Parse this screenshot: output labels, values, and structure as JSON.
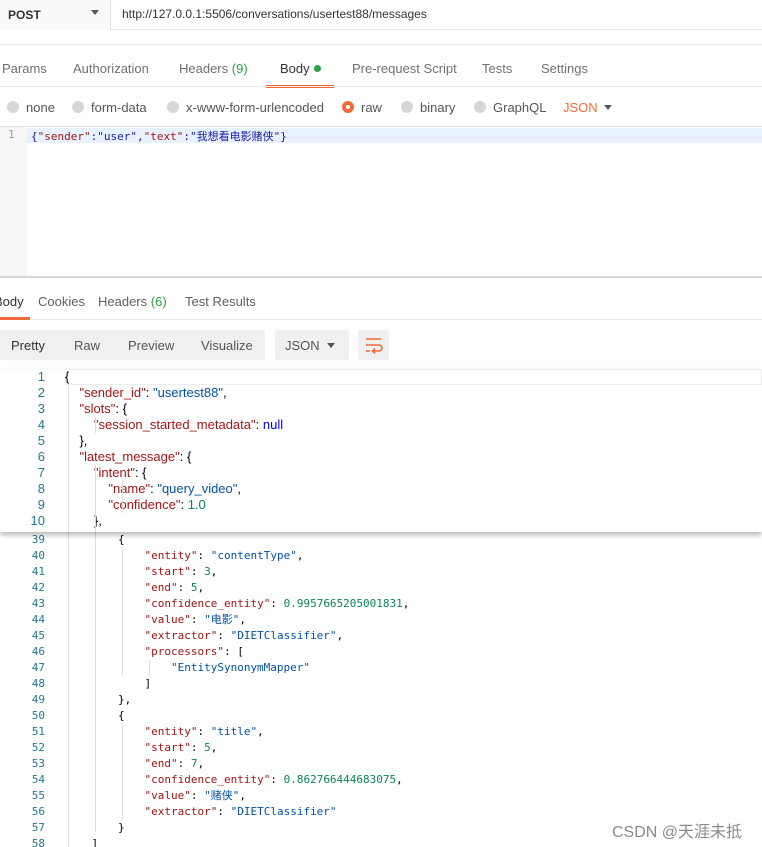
{
  "request": {
    "method": "POST",
    "url": "http://127.0.0.1:5506/conversations/usertest88/messages",
    "tabs": [
      {
        "label": "Params"
      },
      {
        "label": "Authorization"
      },
      {
        "label": "Headers",
        "count": "(9)"
      },
      {
        "label": "Body"
      },
      {
        "label": "Pre-request Script"
      },
      {
        "label": "Tests"
      },
      {
        "label": "Settings"
      }
    ],
    "body_types": [
      "none",
      "form-data",
      "x-www-form-urlencoded",
      "raw",
      "binary",
      "GraphQL"
    ],
    "selected_body_type": "raw",
    "format": "JSON",
    "body_line_number": "1",
    "body": [
      {
        "t": "{",
        "c": ""
      },
      {
        "t": "\"sender\"",
        "c": "k"
      },
      {
        "t": ":",
        "c": ""
      },
      {
        "t": "\"user\"",
        "c": ""
      },
      {
        "t": ",",
        "c": ""
      },
      {
        "t": "\"text\"",
        "c": "k"
      },
      {
        "t": ":",
        "c": ""
      },
      {
        "t": "\"我想看电影赌侠\"",
        "c": ""
      },
      {
        "t": "}",
        "c": ""
      }
    ]
  },
  "response": {
    "tabs": [
      {
        "label": "Body"
      },
      {
        "label": "Cookies"
      },
      {
        "label": "Headers",
        "count": "(6)"
      },
      {
        "label": "Test Results"
      }
    ],
    "views": [
      "Pretty",
      "Raw",
      "Preview",
      "Visualize"
    ],
    "format": "JSON",
    "sticky_lines": [
      {
        "no": "1",
        "tokens": [
          [
            "{",
            ""
          ]
        ]
      },
      {
        "no": "2",
        "tokens": [
          [
            "    ",
            ""
          ],
          [
            "\"sender_id\"",
            "k"
          ],
          [
            ": ",
            ""
          ],
          [
            "\"usertest88\"",
            "s"
          ],
          [
            ",",
            ""
          ]
        ]
      },
      {
        "no": "3",
        "tokens": [
          [
            "    ",
            ""
          ],
          [
            "\"slots\"",
            "k"
          ],
          [
            ": {",
            ""
          ]
        ]
      },
      {
        "no": "4",
        "tokens": [
          [
            "        ",
            ""
          ],
          [
            "\"session_started_metadata\"",
            "k"
          ],
          [
            ": ",
            ""
          ],
          [
            "null",
            "kw"
          ]
        ]
      },
      {
        "no": "5",
        "tokens": [
          [
            "    },",
            ""
          ]
        ]
      },
      {
        "no": "6",
        "tokens": [
          [
            "    ",
            ""
          ],
          [
            "\"latest_message\"",
            "k"
          ],
          [
            ": {",
            ""
          ]
        ]
      },
      {
        "no": "7",
        "tokens": [
          [
            "        ",
            ""
          ],
          [
            "\"intent\"",
            "k"
          ],
          [
            ": {",
            ""
          ]
        ]
      },
      {
        "no": "8",
        "tokens": [
          [
            "            ",
            ""
          ],
          [
            "\"name\"",
            "k"
          ],
          [
            ": ",
            ""
          ],
          [
            "\"query_video\"",
            "s"
          ],
          [
            ",",
            ""
          ]
        ]
      },
      {
        "no": "9",
        "tokens": [
          [
            "            ",
            ""
          ],
          [
            "\"confidence\"",
            "k"
          ],
          [
            ": ",
            ""
          ],
          [
            "1.0",
            "n"
          ]
        ]
      },
      {
        "no": "10",
        "tokens": [
          [
            "        },",
            ""
          ]
        ]
      }
    ],
    "lines": [
      {
        "no": "39",
        "tokens": [
          [
            "        {",
            ""
          ]
        ]
      },
      {
        "no": "40",
        "tokens": [
          [
            "            ",
            ""
          ],
          [
            "\"entity\"",
            "k"
          ],
          [
            ": ",
            ""
          ],
          [
            "\"contentType\"",
            "s"
          ],
          [
            ",",
            ""
          ]
        ]
      },
      {
        "no": "41",
        "tokens": [
          [
            "            ",
            ""
          ],
          [
            "\"start\"",
            "k"
          ],
          [
            ": ",
            ""
          ],
          [
            "3",
            "n"
          ],
          [
            ",",
            ""
          ]
        ]
      },
      {
        "no": "42",
        "tokens": [
          [
            "            ",
            ""
          ],
          [
            "\"end\"",
            "k"
          ],
          [
            ": ",
            ""
          ],
          [
            "5",
            "n"
          ],
          [
            ",",
            ""
          ]
        ]
      },
      {
        "no": "43",
        "tokens": [
          [
            "            ",
            ""
          ],
          [
            "\"confidence_entity\"",
            "k"
          ],
          [
            ": ",
            ""
          ],
          [
            "0.9957665205001831",
            "n"
          ],
          [
            ",",
            ""
          ]
        ]
      },
      {
        "no": "44",
        "tokens": [
          [
            "            ",
            ""
          ],
          [
            "\"value\"",
            "k"
          ],
          [
            ": ",
            ""
          ],
          [
            "\"电影\"",
            "s"
          ],
          [
            ",",
            ""
          ]
        ]
      },
      {
        "no": "45",
        "tokens": [
          [
            "            ",
            ""
          ],
          [
            "\"extractor\"",
            "k"
          ],
          [
            ": ",
            ""
          ],
          [
            "\"DIETClassifier\"",
            "s"
          ],
          [
            ",",
            ""
          ]
        ]
      },
      {
        "no": "46",
        "tokens": [
          [
            "            ",
            ""
          ],
          [
            "\"processors\"",
            "k"
          ],
          [
            ": [",
            ""
          ]
        ]
      },
      {
        "no": "47",
        "tokens": [
          [
            "                ",
            ""
          ],
          [
            "\"EntitySynonymMapper\"",
            "s"
          ]
        ]
      },
      {
        "no": "48",
        "tokens": [
          [
            "            ]",
            ""
          ]
        ]
      },
      {
        "no": "49",
        "tokens": [
          [
            "        },",
            ""
          ]
        ]
      },
      {
        "no": "50",
        "tokens": [
          [
            "        {",
            ""
          ]
        ]
      },
      {
        "no": "51",
        "tokens": [
          [
            "            ",
            ""
          ],
          [
            "\"entity\"",
            "k"
          ],
          [
            ": ",
            ""
          ],
          [
            "\"title\"",
            "s"
          ],
          [
            ",",
            ""
          ]
        ]
      },
      {
        "no": "52",
        "tokens": [
          [
            "            ",
            ""
          ],
          [
            "\"start\"",
            "k"
          ],
          [
            ": ",
            ""
          ],
          [
            "5",
            "n"
          ],
          [
            ",",
            ""
          ]
        ]
      },
      {
        "no": "53",
        "tokens": [
          [
            "            ",
            ""
          ],
          [
            "\"end\"",
            "k"
          ],
          [
            ": ",
            ""
          ],
          [
            "7",
            "n"
          ],
          [
            ",",
            ""
          ]
        ]
      },
      {
        "no": "54",
        "tokens": [
          [
            "            ",
            ""
          ],
          [
            "\"confidence_entity\"",
            "k"
          ],
          [
            ": ",
            ""
          ],
          [
            "0.862766444683075",
            "n"
          ],
          [
            ",",
            ""
          ]
        ]
      },
      {
        "no": "55",
        "tokens": [
          [
            "            ",
            ""
          ],
          [
            "\"value\"",
            "k"
          ],
          [
            ": ",
            ""
          ],
          [
            "\"赌侠\"",
            "s"
          ],
          [
            ",",
            ""
          ]
        ]
      },
      {
        "no": "56",
        "tokens": [
          [
            "            ",
            ""
          ],
          [
            "\"extractor\"",
            "k"
          ],
          [
            ": ",
            ""
          ],
          [
            "\"DIETClassifier\"",
            "s"
          ]
        ]
      },
      {
        "no": "57",
        "tokens": [
          [
            "        }",
            ""
          ]
        ]
      },
      {
        "no": "58",
        "tokens": [
          [
            "    ]",
            ""
          ]
        ]
      }
    ]
  },
  "watermark": "CSDN @天涯未抵",
  "icons": {
    "wrap": "wrap-lines-icon",
    "method_caret": "chevron-down-icon"
  },
  "colors": {
    "accent": "#f26b3a",
    "count": "#2aa146"
  }
}
